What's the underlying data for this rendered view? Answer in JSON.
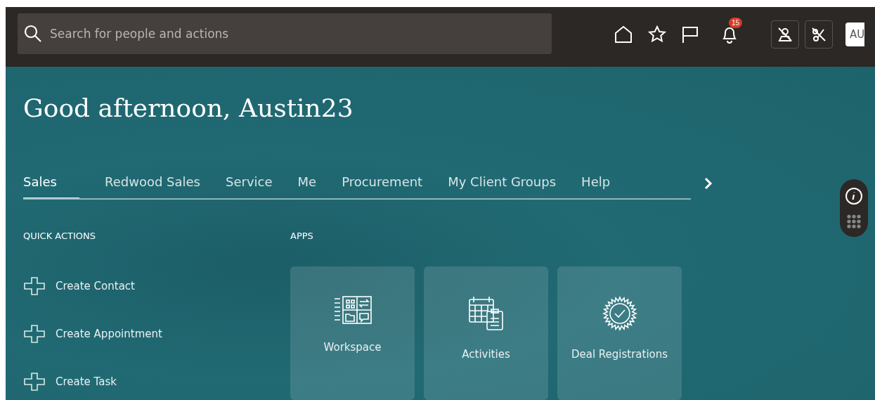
{
  "search": {
    "placeholder": "Search for people and actions"
  },
  "notifications": {
    "count": "15"
  },
  "user": {
    "initials": "AU"
  },
  "greeting": "Good afternoon, Austin23",
  "tabs": [
    {
      "label": "Sales",
      "selected": true
    },
    {
      "label": "Redwood Sales",
      "selected": false
    },
    {
      "label": "Service",
      "selected": false
    },
    {
      "label": "Me",
      "selected": false
    },
    {
      "label": "Procurement",
      "selected": false
    },
    {
      "label": "My Client Groups",
      "selected": false
    },
    {
      "label": "Help",
      "selected": false
    }
  ],
  "quick_actions": {
    "title": "QUICK ACTIONS",
    "items": [
      "Create Contact",
      "Create Appointment",
      "Create Task"
    ]
  },
  "apps": {
    "title": "APPS",
    "items": [
      {
        "label": "Workspace",
        "kind": "workspace"
      },
      {
        "label": "Activities",
        "kind": "calendar"
      },
      {
        "label": "Deal Registrations",
        "kind": "badge"
      }
    ]
  }
}
